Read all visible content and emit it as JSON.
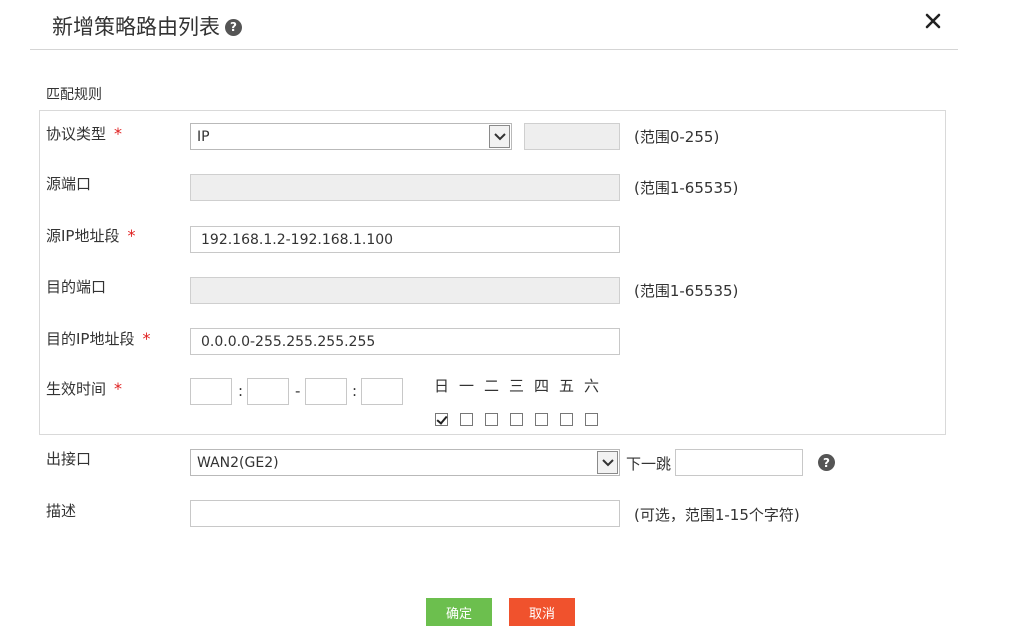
{
  "dialog": {
    "title": "新增策略路由列表",
    "help_glyph": "?",
    "close_glyph": "×"
  },
  "section": {
    "label": "匹配规则"
  },
  "protocol": {
    "label": "协议类型",
    "required": "*",
    "selected": "IP",
    "number_value": "",
    "hint": "(范围0-255)"
  },
  "src_port": {
    "label": "源端口",
    "value": "",
    "hint": "(范围1-65535)"
  },
  "src_ip": {
    "label": "源IP地址段",
    "required": "*",
    "value": "192.168.1.2-192.168.1.100"
  },
  "dst_port": {
    "label": "目的端口",
    "value": "",
    "hint": "(范围1-65535)"
  },
  "dst_ip": {
    "label": "目的IP地址段",
    "required": "*",
    "value": "0.0.0.0-255.255.255.255"
  },
  "effective_time": {
    "label": "生效时间",
    "required": "*",
    "colon": ":",
    "dash": "-",
    "days": [
      "日",
      "一",
      "二",
      "三",
      "四",
      "五",
      "六"
    ],
    "checked": [
      true,
      false,
      false,
      false,
      false,
      false,
      false
    ]
  },
  "outbound": {
    "label": "出接口",
    "selected": "WAN2(GE2)",
    "next_hop_label": "下一跳",
    "next_hop_value": "",
    "help_glyph": "?"
  },
  "description": {
    "label": "描述",
    "value": "",
    "hint": "(可选，范围1-15个字符)"
  },
  "buttons": {
    "ok": "确定",
    "cancel": "取消"
  },
  "colors": {
    "ok": "#6cbf4e",
    "cancel": "#f0522d",
    "required": "#e02020"
  }
}
